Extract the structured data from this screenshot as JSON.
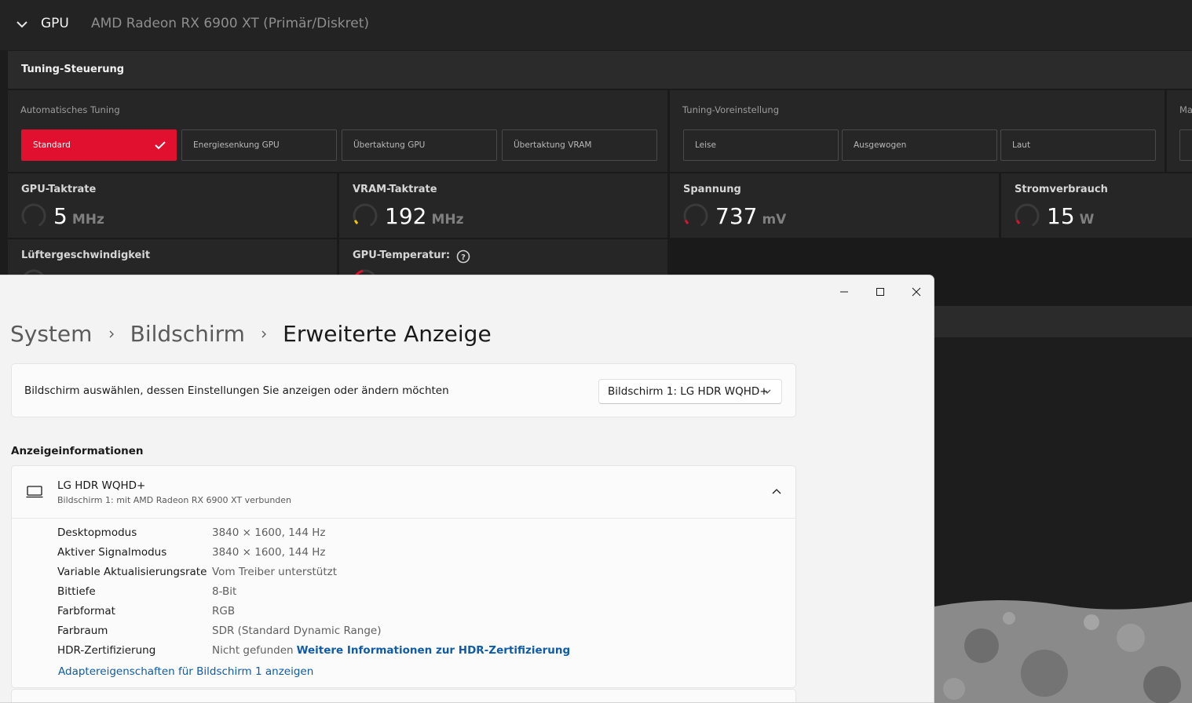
{
  "amd": {
    "section_label": "GPU",
    "gpu_name": "AMD Radeon RX 6900 XT (Primär/Diskret)",
    "tuning_title": "Tuning-Steuerung",
    "auto_tuning": {
      "title": "Automatisches Tuning",
      "options": [
        "Standard",
        "Energiesenkung GPU",
        "Übertaktung GPU",
        "Übertaktung VRAM"
      ],
      "selected": "Standard"
    },
    "preset": {
      "title": "Tuning-Voreinstellung",
      "options": [
        "Leise",
        "Ausgewogen",
        "Laut"
      ]
    },
    "manual_title_cut": "Ma",
    "metrics": [
      {
        "label": "GPU-Taktrate",
        "value": "5",
        "unit": "MHz",
        "gauge_color": "#3a3a3a"
      },
      {
        "label": "VRAM-Taktrate",
        "value": "192",
        "unit": "MHz",
        "gauge_color": "#f5c400"
      },
      {
        "label": "Spannung",
        "value": "737",
        "unit": "mV",
        "gauge_color": "#e1102e"
      },
      {
        "label": "Stromverbrauch",
        "value": "15",
        "unit": "W",
        "gauge_color": "#e1102e"
      },
      {
        "label": "Lüftergeschwindigkeit"
      },
      {
        "label": "GPU-Temperatur:"
      }
    ],
    "accent": "#e1102e"
  },
  "settings": {
    "breadcrumb": [
      "System",
      "Bildschirm",
      "Erweiterte Anzeige"
    ],
    "select_label": "Bildschirm auswählen, dessen Einstellungen Sie anzeigen oder ändern möchten",
    "select_value": "Bildschirm 1: LG HDR WQHD+",
    "section_title": "Anzeigeinformationen",
    "monitor_name": "LG HDR WQHD+",
    "monitor_sub": "Bildschirm 1: mit AMD Radeon RX 6900 XT verbunden",
    "rows": [
      {
        "k": "Desktopmodus",
        "v": "3840 × 1600, 144 Hz"
      },
      {
        "k": "Aktiver Signalmodus",
        "v": "3840 × 1600, 144 Hz"
      },
      {
        "k": "Variable Aktualisierungsrate",
        "v": "Vom Treiber unterstützt"
      },
      {
        "k": "Bittiefe",
        "v": "8-Bit"
      },
      {
        "k": "Farbformat",
        "v": "RGB"
      },
      {
        "k": "Farbraum",
        "v": "SDR (Standard Dynamic Range)"
      },
      {
        "k": "HDR-Zertifizierung",
        "v": "Nicht gefunden",
        "link": "Weitere Informationen zur HDR-Zertifizierung"
      }
    ],
    "adapter_link": "Adaptereigenschaften für Bildschirm 1 anzeigen",
    "link_color": "#0f5ba7"
  }
}
